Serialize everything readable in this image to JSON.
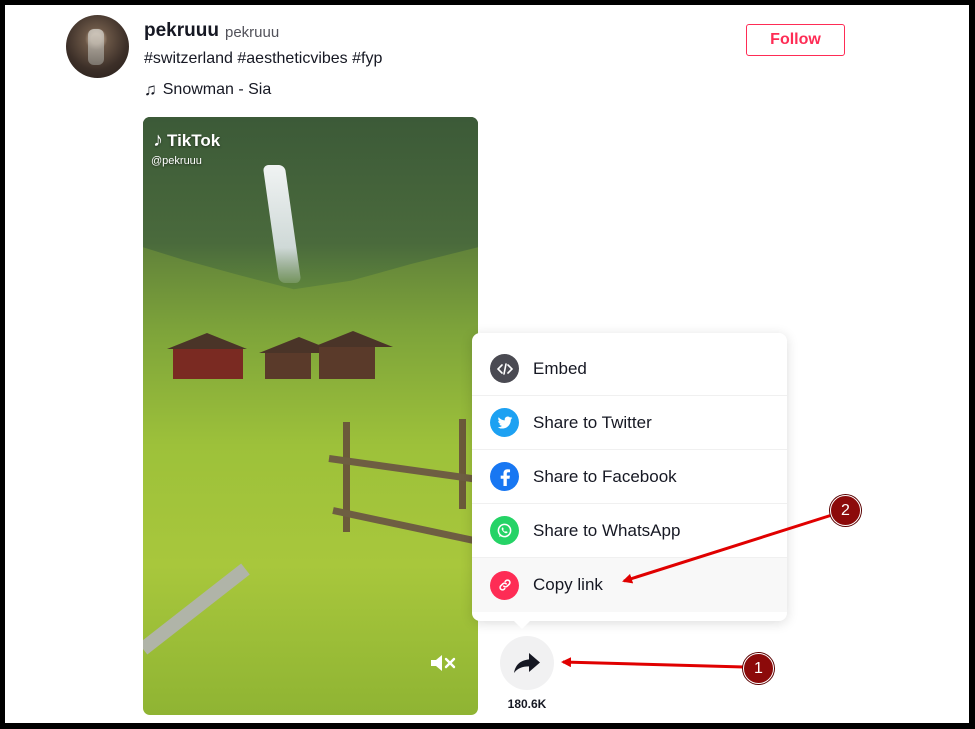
{
  "post": {
    "username": "pekruuu",
    "nickname": "pekruuu",
    "caption": "#switzerland #aestheticvibes #fyp",
    "music": "Snowman - Sia",
    "follow_label": "Follow"
  },
  "video": {
    "watermark_brand": "TikTok",
    "watermark_handle": "@pekruuu",
    "muted": true
  },
  "share": {
    "count": "180.6K",
    "menu": [
      {
        "label": "Embed",
        "icon": "embed-icon",
        "color": "#4a4a52"
      },
      {
        "label": "Share to Twitter",
        "icon": "twitter-icon",
        "color": "#1da1f2"
      },
      {
        "label": "Share to Facebook",
        "icon": "facebook-icon",
        "color": "#1877f2"
      },
      {
        "label": "Share to WhatsApp",
        "icon": "whatsapp-icon",
        "color": "#25d366"
      },
      {
        "label": "Copy link",
        "icon": "link-icon",
        "color": "#fe2c55"
      }
    ]
  },
  "annotations": {
    "step1": "1",
    "step2": "2",
    "color": "#e00000"
  }
}
